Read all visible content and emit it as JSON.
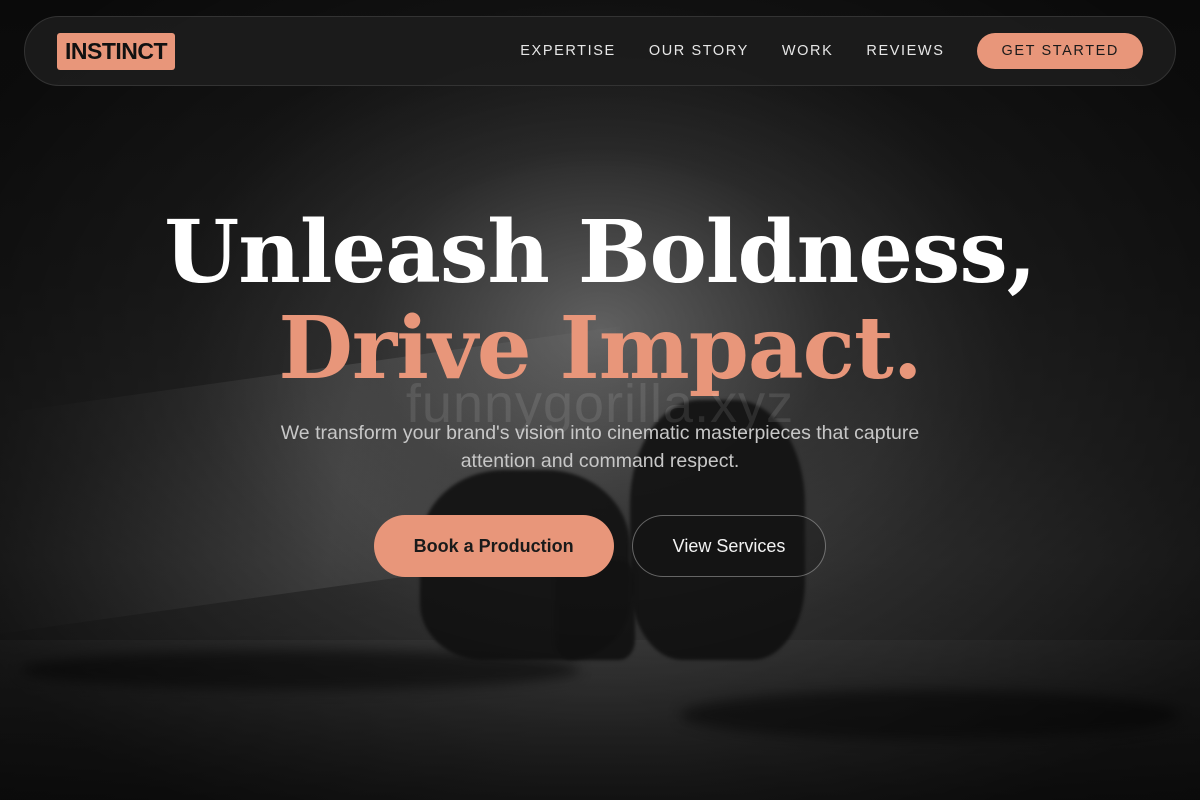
{
  "brand": {
    "logo_text": "INSTINCT",
    "accent_color": "#e8967a"
  },
  "nav": {
    "items": [
      {
        "label": "EXPERTISE"
      },
      {
        "label": "OUR STORY"
      },
      {
        "label": "WORK"
      },
      {
        "label": "REVIEWS"
      }
    ],
    "cta_label": "GET STARTED"
  },
  "hero": {
    "headline_line1": "Unleash Boldness,",
    "headline_line2": "Drive Impact.",
    "watermark": "funnygorilla.xyz",
    "subtitle": "We transform your brand's vision into cinematic masterpieces that capture attention and command respect.",
    "primary_button": "Book a Production",
    "secondary_button": "View Services"
  },
  "background": {
    "description_icon": "film-crew-photo"
  }
}
